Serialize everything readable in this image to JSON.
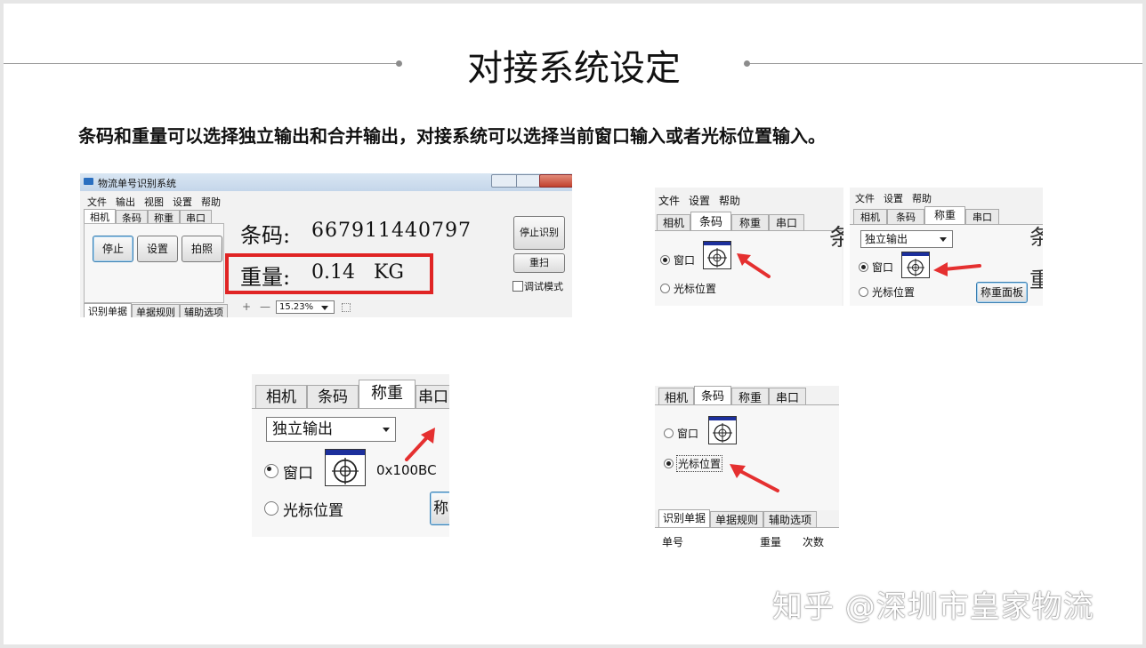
{
  "slide": {
    "title": "对接系统设定",
    "subtitle": "条码和重量可以选择独立输出和合并输出，对接系统可以选择当前窗口输入或者光标位置输入。"
  },
  "shot1": {
    "window_title": "物流单号识别系统",
    "menu": [
      "文件",
      "输出",
      "视图",
      "设置",
      "帮助"
    ],
    "tabs": [
      "相机",
      "条码",
      "称重",
      "串口"
    ],
    "buttons": {
      "stop": "停止",
      "settings": "设置",
      "photo": "拍照",
      "stop_recognition": "停止识别",
      "rescan": "重扫"
    },
    "barcode_label": "条码:",
    "barcode_value": "667911440797",
    "weight_label": "重量:",
    "weight_value": "0.14",
    "weight_unit": "KG",
    "debug_mode": "调试模式",
    "bottom_tabs": [
      "识别单据",
      "单据规则",
      "辅助选项"
    ],
    "zoom": "15.23%",
    "zoom_plus": "+",
    "zoom_minus": "—",
    "highlight_color": "#e02424"
  },
  "shot2": {
    "menu": [
      "文件",
      "设置",
      "帮助"
    ],
    "tabs": [
      "相机",
      "条码",
      "称重",
      "串口"
    ],
    "radio_window": "窗口",
    "radio_cursor": "光标位置",
    "cut_char": "条"
  },
  "shot3": {
    "menu": [
      "文件",
      "设置",
      "帮助"
    ],
    "tabs": [
      "相机",
      "条码",
      "称重",
      "串口"
    ],
    "select_value": "独立输出",
    "radio_window": "窗口",
    "radio_cursor": "光标位置",
    "weigh_panel": "称重面板",
    "cut_chars": [
      "条",
      "重"
    ]
  },
  "shot4": {
    "tabs": [
      "相机",
      "条码",
      "称重",
      "串口"
    ],
    "select_value": "独立输出",
    "radio_window": "窗口",
    "handle": "0x100BC",
    "radio_cursor": "光标位置",
    "cut_button": "称"
  },
  "shot5": {
    "tabs": [
      "相机",
      "条码",
      "称重",
      "串口"
    ],
    "radio_window": "窗口",
    "radio_cursor": "光标位置",
    "bottom_tabs": [
      "识别单据",
      "单据规则",
      "辅助选项"
    ],
    "columns": [
      "单号",
      "重量",
      "次数"
    ]
  },
  "watermark": "知乎 @深圳市皇家物流",
  "colors": {
    "arrow": "#e53030",
    "icon_bar": "#1c2f9c"
  }
}
